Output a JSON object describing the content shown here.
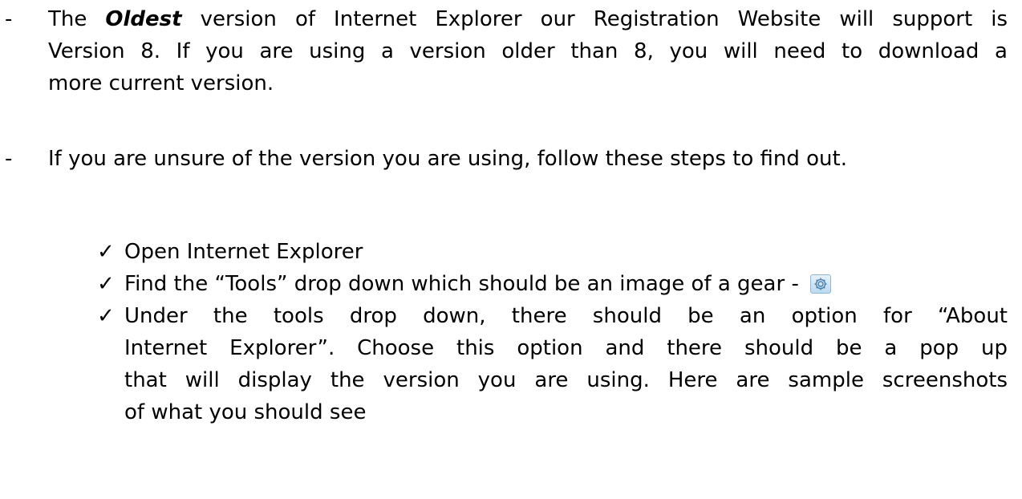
{
  "paragraphs": [
    {
      "bullet": "-",
      "lines": [
        {
          "pre": "The ",
          "emph": "Oldest",
          "post": " version of Internet Explorer our Registration Website will support is"
        },
        {
          "text": "Version 8.  If you are using a version older than 8, you will need to download a"
        },
        {
          "text": "more current version."
        }
      ]
    },
    {
      "bullet": "-",
      "lines": [
        {
          "text": "If you are unsure of the version you are using, follow these steps to find out."
        }
      ]
    }
  ],
  "steps": [
    {
      "bullet": "✓",
      "lines": [
        "Open Internet Explorer"
      ]
    },
    {
      "bullet": "✓",
      "lines": [
        "Find the “Tools” drop down which should be an image of a gear - "
      ],
      "icon": "gear-icon"
    },
    {
      "bullet": "✓",
      "lines": [
        "Under the tools drop down, there should be an option for “About",
        "Internet Explorer”.  Choose this option and there should be a pop up",
        "that will display the version you are using.  Here are sample screenshots",
        "of what you should see"
      ]
    }
  ],
  "colors": {
    "text": "#000000",
    "gear_bg": "#d4e7f6",
    "gear_fg": "#4a7fb0"
  }
}
